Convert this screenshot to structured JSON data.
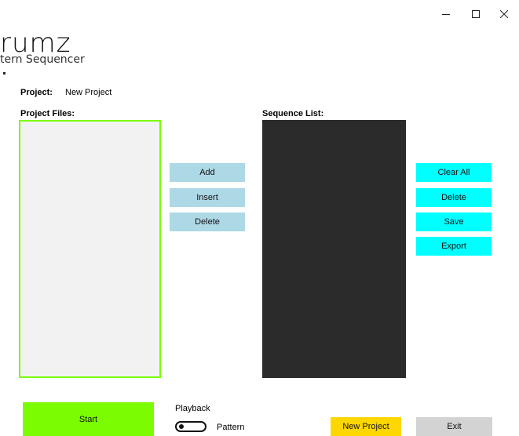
{
  "app": {
    "logo_title": "rumz",
    "logo_subtitle": "tern Sequencer"
  },
  "project": {
    "label": "Project:",
    "name": "New Project"
  },
  "files": {
    "label": "Project Files:",
    "buttons": {
      "add": "Add",
      "insert": "Insert",
      "delete": "Delete"
    }
  },
  "sequence": {
    "label": "Sequence List:",
    "buttons": {
      "clear_all": "Clear All",
      "delete": "Delete",
      "save": "Save",
      "export": "Export"
    }
  },
  "footer": {
    "start": "Start",
    "playback_label": "Playback",
    "toggle_label": "Pattern",
    "toggle_on": false,
    "new_project": "New Project",
    "exit": "Exit"
  },
  "colors": {
    "start_green": "#7cfc00",
    "files_border": "#7cfc00",
    "sequence_bg": "#2b2b2b",
    "files_buttons": "#add8e6",
    "sequence_buttons": "#00ffff",
    "new_project": "#ffd700",
    "exit": "#d3d3d3"
  }
}
